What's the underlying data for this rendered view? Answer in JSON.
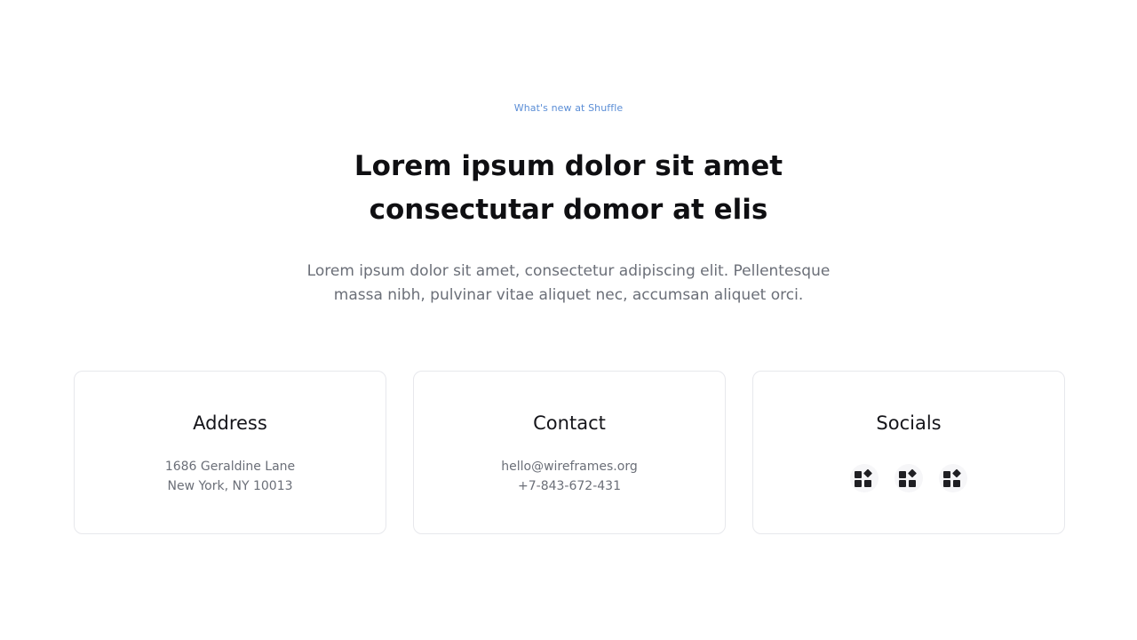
{
  "hero": {
    "eyebrow": "What's new at Shuffle",
    "title_line1": "Lorem ipsum dolor sit amet",
    "title_line2": "consectutar domor at elis",
    "lead_line1": "Lorem ipsum dolor sit amet, consectetur adipiscing elit. Pellentesque",
    "lead_line2": "massa nibh, pulvinar vitae aliquet nec, accumsan aliquet orci."
  },
  "cards": {
    "address": {
      "title": "Address",
      "line1": "1686 Geraldine Lane",
      "line2": "New York, NY 10013"
    },
    "contact": {
      "title": "Contact",
      "email": "hello@wireframes.org",
      "phone": "+7-843-672-431"
    },
    "socials": {
      "title": "Socials",
      "icons": [
        "app-grid-icon",
        "app-grid-icon",
        "app-grid-icon"
      ]
    }
  },
  "colors": {
    "accent": "#5b8ed6",
    "heading": "#0f0f12",
    "body_text": "#6b6f78",
    "card_border": "#e7e8ec"
  }
}
